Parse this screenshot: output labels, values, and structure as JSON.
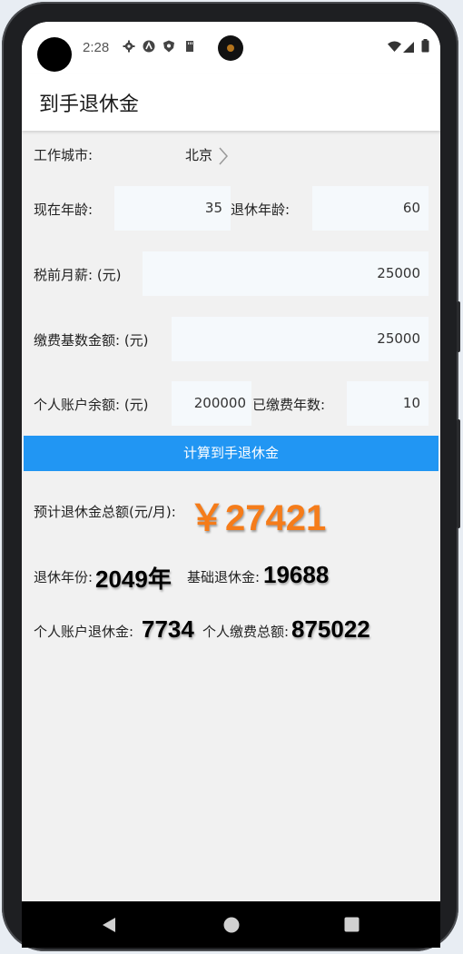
{
  "status_bar": {
    "time": "2:28"
  },
  "app_bar": {
    "title": "到手退休金"
  },
  "form": {
    "city_label": "工作城市:",
    "city_value": "北京",
    "age_label": "现在年龄:",
    "age_value": "35",
    "retire_age_label": "退休年龄:",
    "retire_age_value": "60",
    "salary_label": "税前月薪: (元)",
    "salary_value": "25000",
    "base_label": "缴费基数金额: (元)",
    "base_value": "25000",
    "account_label": "个人账户余额: (元)",
    "account_value": "200000",
    "paid_years_label": "已缴费年数:",
    "paid_years_value": "10",
    "calc_button": "计算到手退休金"
  },
  "results": {
    "total_label": "预计退休金总额(元/月):",
    "total_value": "￥27421",
    "retire_year_label": "退休年份:",
    "retire_year_value": "2049年",
    "basic_label": "基础退休金:",
    "basic_value": "19688",
    "personal_label": "个人账户退休金:",
    "personal_value": "7734",
    "paid_total_label": "个人缴费总额:",
    "paid_total_value": "875022"
  },
  "colors": {
    "accent": "#2196f3",
    "total": "#f57c1a"
  },
  "icons": [
    "settings-icon",
    "assistant-icon",
    "shield-icon",
    "sd-card-icon",
    "wifi-icon",
    "signal-icon",
    "battery-icon",
    "chevron-right-icon",
    "back-icon",
    "home-icon",
    "recents-icon"
  ]
}
